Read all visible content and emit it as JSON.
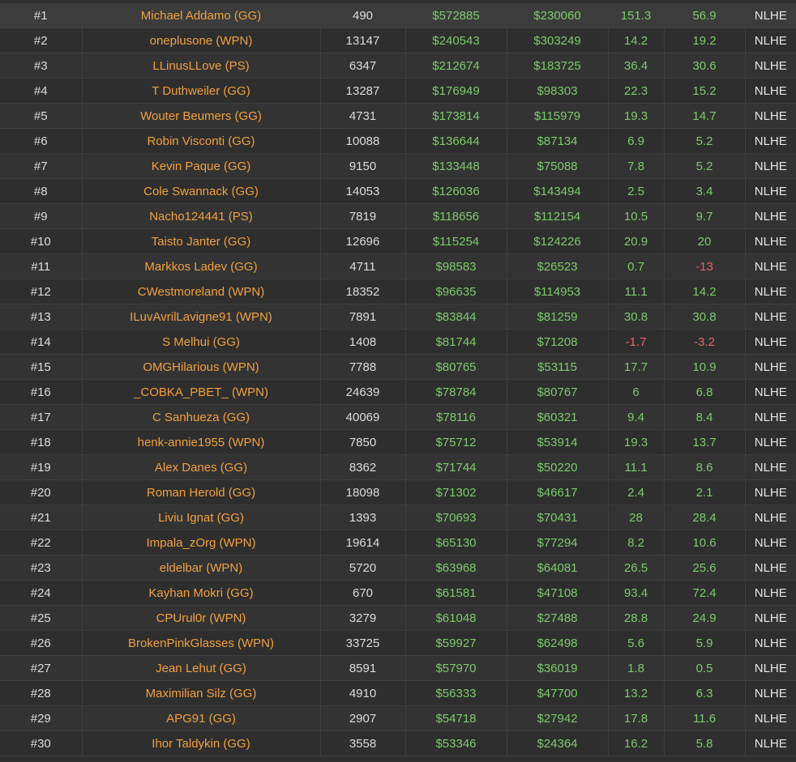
{
  "colors": {
    "player": "#f0a040",
    "positive": "#7ccb6b",
    "negative": "#ee6363"
  },
  "rows": [
    {
      "rank": "#1",
      "player": "Michael Addamo (GG)",
      "hands": "490",
      "col_a": "$572885",
      "col_b": "$230060",
      "stat_1": "151.3",
      "stat_2": "56.9",
      "game": "NLHE"
    },
    {
      "rank": "#2",
      "player": "oneplusone (WPN)",
      "hands": "13147",
      "col_a": "$240543",
      "col_b": "$303249",
      "stat_1": "14.2",
      "stat_2": "19.2",
      "game": "NLHE"
    },
    {
      "rank": "#3",
      "player": "LLinusLLove (PS)",
      "hands": "6347",
      "col_a": "$212674",
      "col_b": "$183725",
      "stat_1": "36.4",
      "stat_2": "30.6",
      "game": "NLHE"
    },
    {
      "rank": "#4",
      "player": "T Duthweiler (GG)",
      "hands": "13287",
      "col_a": "$176949",
      "col_b": "$98303",
      "stat_1": "22.3",
      "stat_2": "15.2",
      "game": "NLHE"
    },
    {
      "rank": "#5",
      "player": "Wouter Beumers (GG)",
      "hands": "4731",
      "col_a": "$173814",
      "col_b": "$115979",
      "stat_1": "19.3",
      "stat_2": "14.7",
      "game": "NLHE"
    },
    {
      "rank": "#6",
      "player": "Robin Visconti (GG)",
      "hands": "10088",
      "col_a": "$136644",
      "col_b": "$87134",
      "stat_1": "6.9",
      "stat_2": "5.2",
      "game": "NLHE"
    },
    {
      "rank": "#7",
      "player": "Kevin Paque (GG)",
      "hands": "9150",
      "col_a": "$133448",
      "col_b": "$75088",
      "stat_1": "7.8",
      "stat_2": "5.2",
      "game": "NLHE"
    },
    {
      "rank": "#8",
      "player": "Cole Swannack (GG)",
      "hands": "14053",
      "col_a": "$126036",
      "col_b": "$143494",
      "stat_1": "2.5",
      "stat_2": "3.4",
      "game": "NLHE"
    },
    {
      "rank": "#9",
      "player": "Nacho124441 (PS)",
      "hands": "7819",
      "col_a": "$118656",
      "col_b": "$112154",
      "stat_1": "10.5",
      "stat_2": "9.7",
      "game": "NLHE"
    },
    {
      "rank": "#10",
      "player": "Taisto Janter (GG)",
      "hands": "12696",
      "col_a": "$115254",
      "col_b": "$124226",
      "stat_1": "20.9",
      "stat_2": "20",
      "game": "NLHE"
    },
    {
      "rank": "#11",
      "player": "Markkos Ladev (GG)",
      "hands": "4711",
      "col_a": "$98583",
      "col_b": "$26523",
      "stat_1": "0.7",
      "stat_2": "-13",
      "game": "NLHE"
    },
    {
      "rank": "#12",
      "player": "CWestmoreland (WPN)",
      "hands": "18352",
      "col_a": "$96635",
      "col_b": "$114953",
      "stat_1": "11.1",
      "stat_2": "14.2",
      "game": "NLHE"
    },
    {
      "rank": "#13",
      "player": "ILuvAvrilLavigne91 (WPN)",
      "hands": "7891",
      "col_a": "$83844",
      "col_b": "$81259",
      "stat_1": "30.8",
      "stat_2": "30.8",
      "game": "NLHE"
    },
    {
      "rank": "#14",
      "player": "S Melhui (GG)",
      "hands": "1408",
      "col_a": "$81744",
      "col_b": "$71208",
      "stat_1": "-1.7",
      "stat_2": "-3.2",
      "game": "NLHE"
    },
    {
      "rank": "#15",
      "player": "OMGHilarious (WPN)",
      "hands": "7788",
      "col_a": "$80765",
      "col_b": "$53115",
      "stat_1": "17.7",
      "stat_2": "10.9",
      "game": "NLHE"
    },
    {
      "rank": "#16",
      "player": "_COBKA_PBET_ (WPN)",
      "hands": "24639",
      "col_a": "$78784",
      "col_b": "$80767",
      "stat_1": "6",
      "stat_2": "6.8",
      "game": "NLHE"
    },
    {
      "rank": "#17",
      "player": "C Sanhueza (GG)",
      "hands": "40069",
      "col_a": "$78116",
      "col_b": "$60321",
      "stat_1": "9.4",
      "stat_2": "8.4",
      "game": "NLHE"
    },
    {
      "rank": "#18",
      "player": "henk-annie1955 (WPN)",
      "hands": "7850",
      "col_a": "$75712",
      "col_b": "$53914",
      "stat_1": "19.3",
      "stat_2": "13.7",
      "game": "NLHE"
    },
    {
      "rank": "#19",
      "player": "Alex Danes (GG)",
      "hands": "8362",
      "col_a": "$71744",
      "col_b": "$50220",
      "stat_1": "11.1",
      "stat_2": "8.6",
      "game": "NLHE"
    },
    {
      "rank": "#20",
      "player": "Roman Herold (GG)",
      "hands": "18098",
      "col_a": "$71302",
      "col_b": "$46617",
      "stat_1": "2.4",
      "stat_2": "2.1",
      "game": "NLHE"
    },
    {
      "rank": "#21",
      "player": "Liviu Ignat (GG)",
      "hands": "1393",
      "col_a": "$70693",
      "col_b": "$70431",
      "stat_1": "28",
      "stat_2": "28.4",
      "game": "NLHE"
    },
    {
      "rank": "#22",
      "player": "Impala_zOrg (WPN)",
      "hands": "19614",
      "col_a": "$65130",
      "col_b": "$77294",
      "stat_1": "8.2",
      "stat_2": "10.6",
      "game": "NLHE"
    },
    {
      "rank": "#23",
      "player": "eldelbar (WPN)",
      "hands": "5720",
      "col_a": "$63968",
      "col_b": "$64081",
      "stat_1": "26.5",
      "stat_2": "25.6",
      "game": "NLHE"
    },
    {
      "rank": "#24",
      "player": "Kayhan Mokri (GG)",
      "hands": "670",
      "col_a": "$61581",
      "col_b": "$47108",
      "stat_1": "93.4",
      "stat_2": "72.4",
      "game": "NLHE"
    },
    {
      "rank": "#25",
      "player": "CPUrul0r (WPN)",
      "hands": "3279",
      "col_a": "$61048",
      "col_b": "$27488",
      "stat_1": "28.8",
      "stat_2": "24.9",
      "game": "NLHE"
    },
    {
      "rank": "#26",
      "player": "BrokenPinkGlasses (WPN)",
      "hands": "33725",
      "col_a": "$59927",
      "col_b": "$62498",
      "stat_1": "5.6",
      "stat_2": "5.9",
      "game": "NLHE"
    },
    {
      "rank": "#27",
      "player": "Jean Lehut (GG)",
      "hands": "8591",
      "col_a": "$57970",
      "col_b": "$36019",
      "stat_1": "1.8",
      "stat_2": "0.5",
      "game": "NLHE"
    },
    {
      "rank": "#28",
      "player": "Maximilian Silz (GG)",
      "hands": "4910",
      "col_a": "$56333",
      "col_b": "$47700",
      "stat_1": "13.2",
      "stat_2": "6.3",
      "game": "NLHE"
    },
    {
      "rank": "#29",
      "player": "APG91 (GG)",
      "hands": "2907",
      "col_a": "$54718",
      "col_b": "$27942",
      "stat_1": "17.8",
      "stat_2": "11.6",
      "game": "NLHE"
    },
    {
      "rank": "#30",
      "player": "Ihor Taldykin (GG)",
      "hands": "3558",
      "col_a": "$53346",
      "col_b": "$24364",
      "stat_1": "16.2",
      "stat_2": "5.8",
      "game": "NLHE"
    }
  ]
}
